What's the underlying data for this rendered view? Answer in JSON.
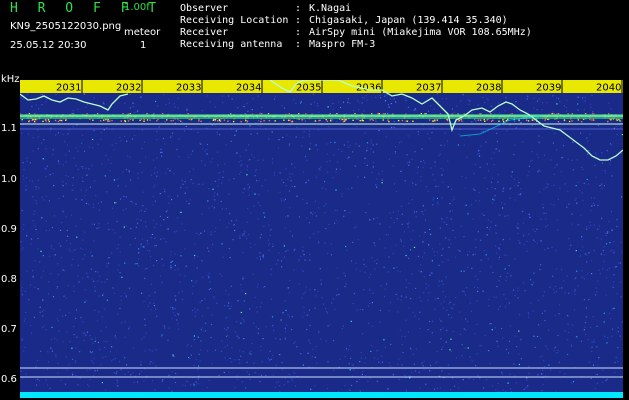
{
  "header": {
    "brand": "H R O F F T",
    "version": "1.00f",
    "filename": "KN9_2505122030.png",
    "meteor_label": "meteor",
    "timestamp": "25.05.12 20:30",
    "meteor_count": "1"
  },
  "info": [
    {
      "key": "Observer",
      "value": "K.Nagai"
    },
    {
      "key": "Receiving Location",
      "value": "Chigasaki, Japan (139.414 35.340)"
    },
    {
      "key": "Receiver",
      "value": "AirSpy mini (Miakejima VOR 108.65MHz)"
    },
    {
      "key": "Receiving antenna",
      "value": "Maspro FM-3"
    }
  ],
  "axis": {
    "unit": "kHz",
    "y_ticks": [
      "1.1",
      "1.0",
      "0.9",
      "0.8",
      "0.7",
      "0.6"
    ],
    "x_ticks": [
      "2031",
      "2032",
      "2033",
      "2034",
      "2035",
      "2036",
      "2037",
      "2038",
      "2039",
      "2040"
    ]
  },
  "colors": {
    "bg": "#000000",
    "spectrogram_bg": "#1a2a88",
    "tick_bar": "#e8e800",
    "trace": "#b8ffd0",
    "title_green": "#2ee04a",
    "cyan": "#00e8ff"
  }
}
